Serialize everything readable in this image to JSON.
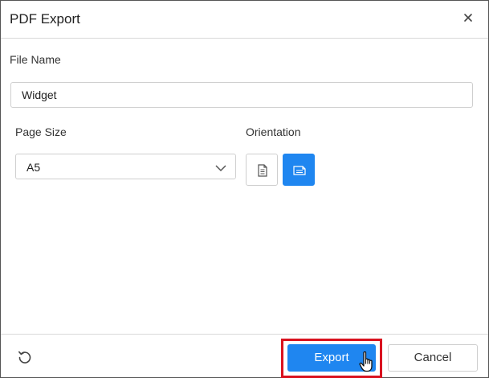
{
  "dialog": {
    "title": "PDF Export",
    "close_icon": "close-icon"
  },
  "file_name": {
    "label": "File Name",
    "value": "Widget"
  },
  "page_size": {
    "label": "Page Size",
    "selected": "A5",
    "chevron_icon": "chevron-down-icon"
  },
  "orientation": {
    "label": "Orientation",
    "options": [
      {
        "name": "portrait",
        "icon": "portrait-page-icon",
        "selected": false
      },
      {
        "name": "landscape",
        "icon": "landscape-page-icon",
        "selected": true
      }
    ]
  },
  "footer": {
    "reset_icon": "reset-icon",
    "export_label": "Export",
    "cancel_label": "Cancel"
  },
  "colors": {
    "accent": "#1f86f0",
    "highlight": "#d9121f",
    "border": "#cfcfcf"
  }
}
